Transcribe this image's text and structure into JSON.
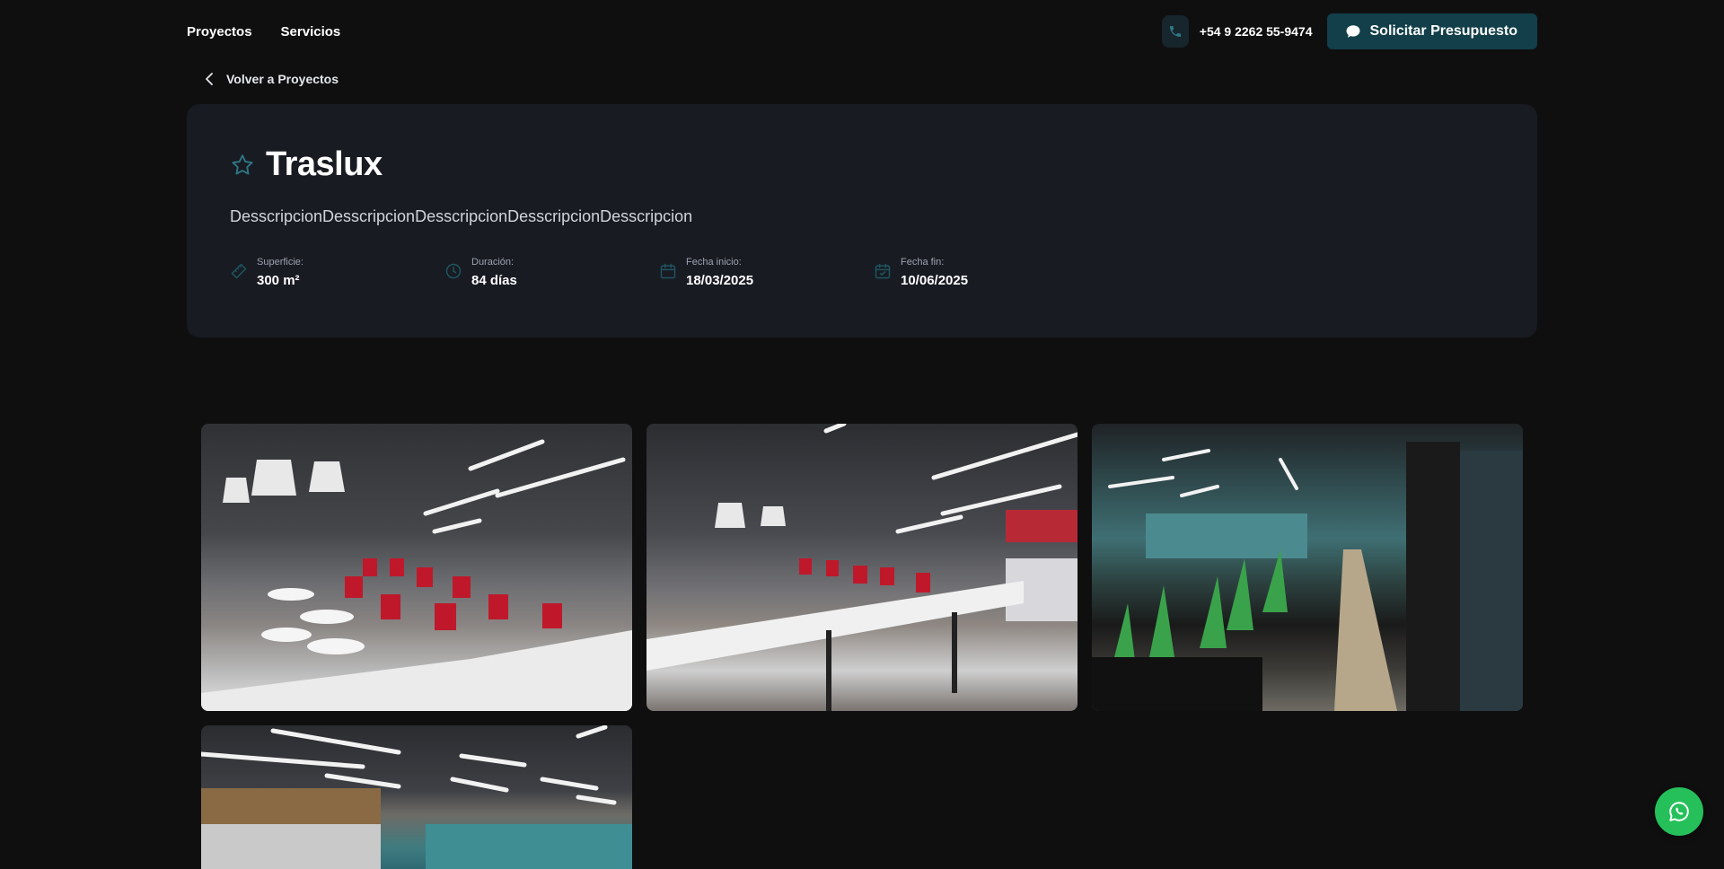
{
  "nav": {
    "links": [
      "Proyectos",
      "Servicios"
    ],
    "phone": "+54 9 2262 55-9474",
    "cta_label": "Solicitar Presupuesto"
  },
  "back_label": "Volver a Proyectos",
  "project": {
    "title": "Traslux",
    "description": "DesscripcionDesscripcionDesscripcionDesscripcionDesscripcion",
    "stats": [
      {
        "label": "Superficie:",
        "value": "300 m²",
        "icon": "ruler-icon"
      },
      {
        "label": "Duración:",
        "value": "84 días",
        "icon": "clock-icon"
      },
      {
        "label": "Fecha inicio:",
        "value": "18/03/2025",
        "icon": "calendar-icon"
      },
      {
        "label": "Fecha fin:",
        "value": "10/06/2025",
        "icon": "calendar-check-icon"
      }
    ]
  },
  "gallery": {
    "photos": [
      "cafeteria-red-chairs",
      "cafeteria-counter",
      "corridor-plants",
      "kitchen-teal-tiles"
    ]
  },
  "colors": {
    "background": "#0f0f10",
    "card": "#181b22",
    "accent": "#123f4a",
    "icon_teal": "#1f5560",
    "whatsapp": "#25c05a"
  }
}
